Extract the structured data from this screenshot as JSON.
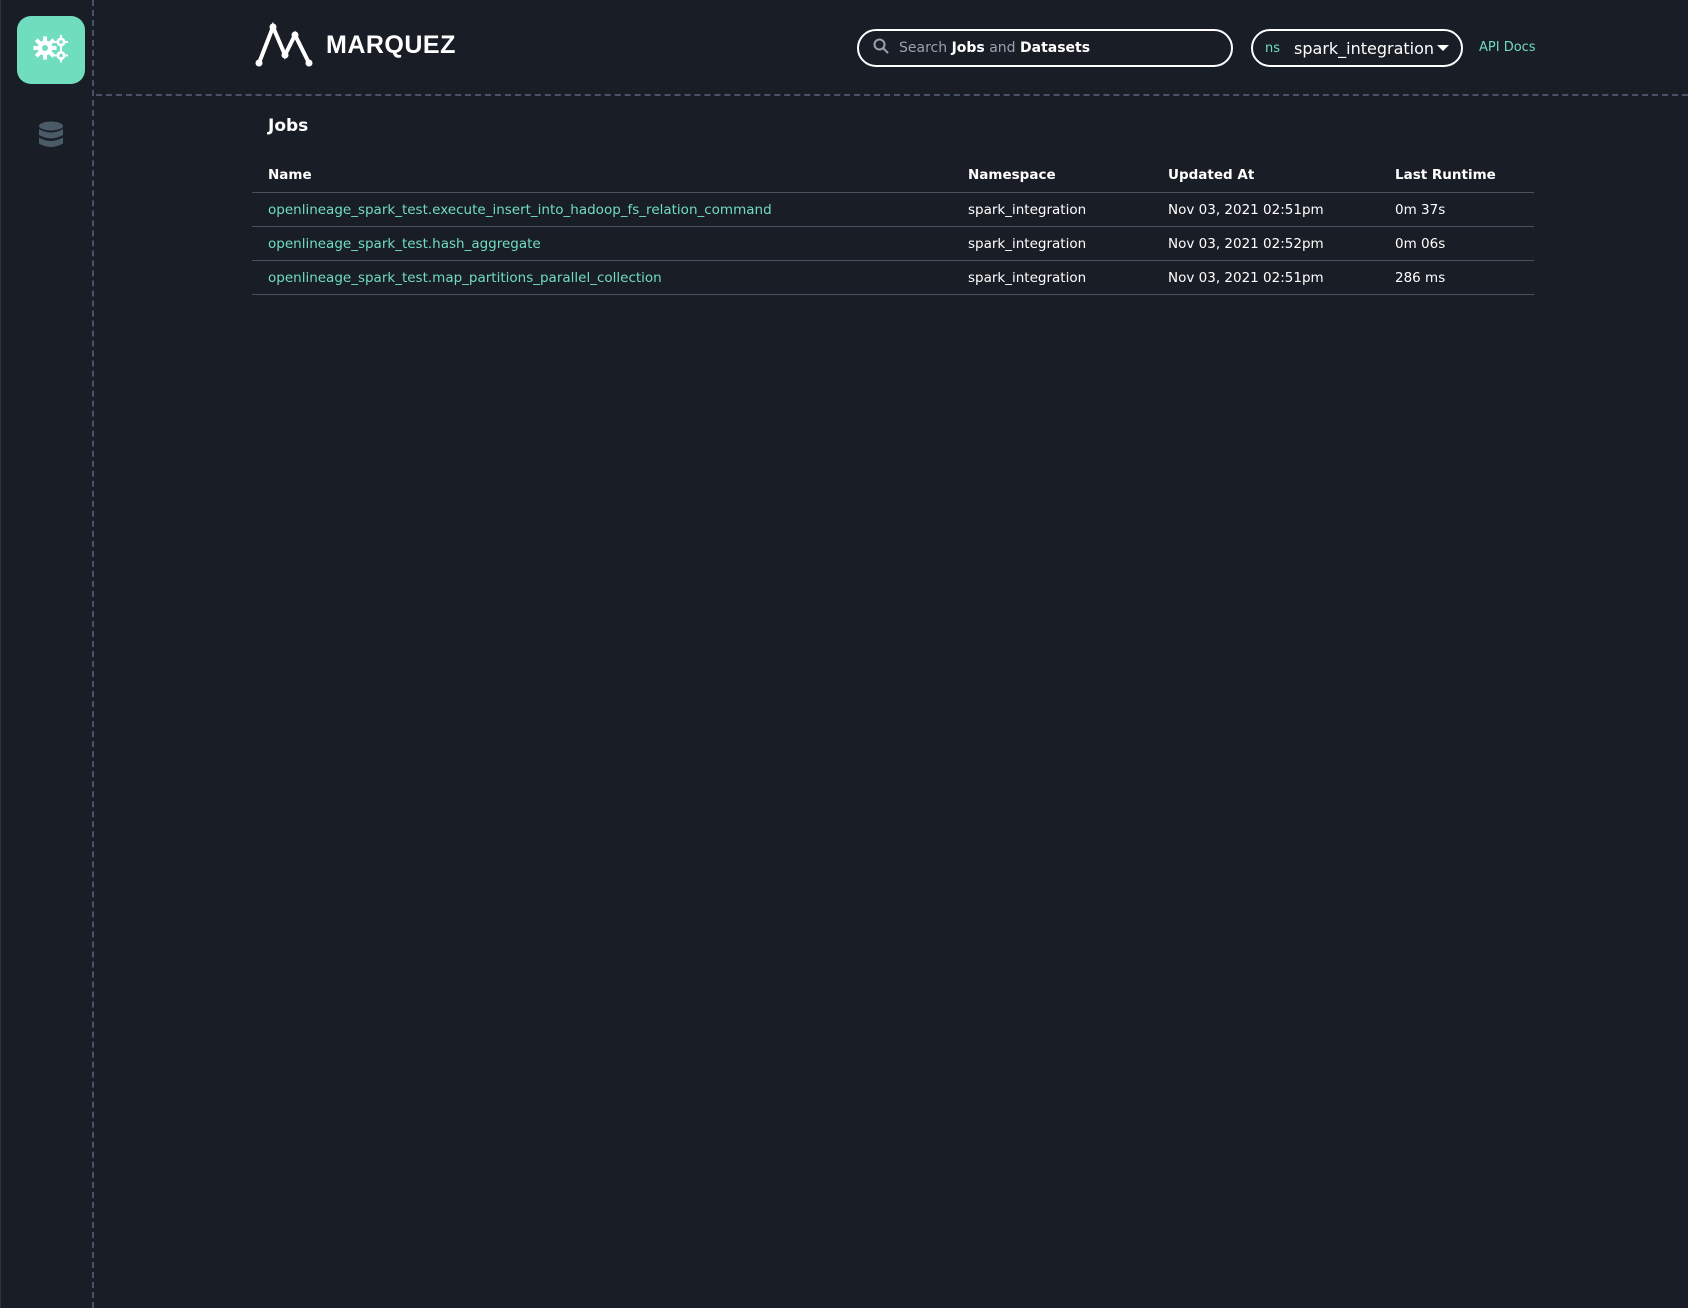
{
  "sidebar": {
    "items": [
      {
        "icon": "gears-icon",
        "active": true
      },
      {
        "icon": "database-icon",
        "active": false
      }
    ],
    "accent_color": "#71ddbf"
  },
  "header": {
    "logo_text": "MARQUEZ",
    "search": {
      "prefix": "Search",
      "term_jobs": "Jobs",
      "conjunction": "and",
      "term_datasets": "Datasets"
    },
    "namespace": {
      "prefix": "ns",
      "value": "spark_integration"
    },
    "api_docs_label": "API Docs"
  },
  "main": {
    "title": "Jobs",
    "table": {
      "columns": [
        "Name",
        "Namespace",
        "Updated At",
        "Last Runtime"
      ],
      "rows": [
        {
          "name": "openlineage_spark_test.execute_insert_into_hadoop_fs_relation_command",
          "namespace": "spark_integration",
          "updated_at": "Nov 03, 2021 02:51pm",
          "last_runtime": "0m 37s"
        },
        {
          "name": "openlineage_spark_test.hash_aggregate",
          "namespace": "spark_integration",
          "updated_at": "Nov 03, 2021 02:52pm",
          "last_runtime": "0m 06s"
        },
        {
          "name": "openlineage_spark_test.map_partitions_parallel_collection",
          "namespace": "spark_integration",
          "updated_at": "Nov 03, 2021 02:51pm",
          "last_runtime": "286 ms"
        }
      ]
    }
  },
  "colors": {
    "background": "#191d26",
    "accent": "#71ddbf",
    "text": "#ffffff"
  }
}
